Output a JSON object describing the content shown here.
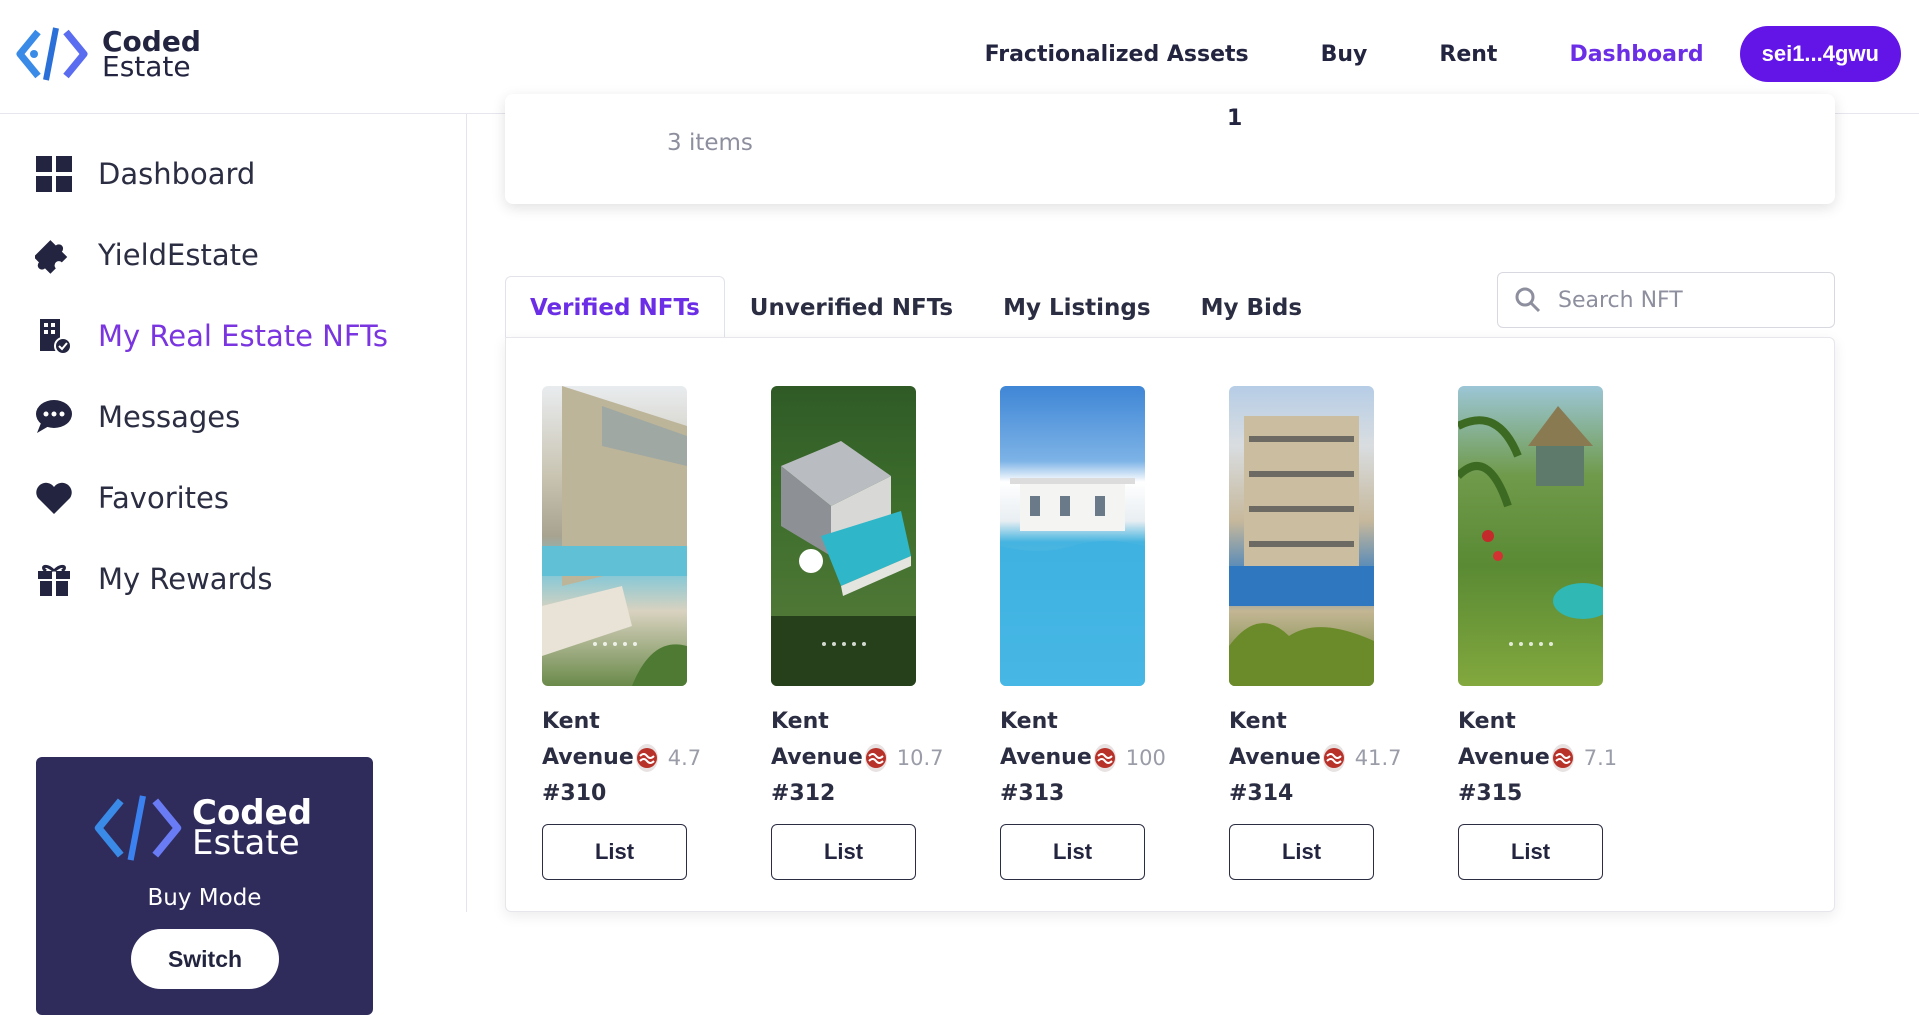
{
  "brand": {
    "line1": "Coded",
    "line2": "Estate"
  },
  "nav": {
    "links": [
      "Fractionalized Assets",
      "Buy",
      "Rent",
      "Dashboard"
    ],
    "active": "Dashboard",
    "wallet": "sei1...4gwu"
  },
  "sidebar": {
    "items": [
      {
        "label": "Dashboard",
        "icon": "grid-icon"
      },
      {
        "label": "YieldEstate",
        "icon": "puzzle-icon"
      },
      {
        "label": "My Real Estate NFTs",
        "icon": "building-check-icon",
        "active": true
      },
      {
        "label": "Messages",
        "icon": "chat-bubble-icon"
      },
      {
        "label": "Favorites",
        "icon": "heart-icon"
      },
      {
        "label": "My Rewards",
        "icon": "gift-icon"
      }
    ],
    "mode_card": {
      "brand_line1": "Coded",
      "brand_line2": "Estate",
      "label": "Buy Mode",
      "button": "Switch"
    }
  },
  "summary": {
    "items_text": "3 items",
    "value": "1"
  },
  "tabs": [
    "Verified NFTs",
    "Unverified NFTs",
    "My Listings",
    "My Bids"
  ],
  "active_tab": "Verified NFTs",
  "search": {
    "placeholder": "Search NFT"
  },
  "nfts": [
    {
      "name": "Kent",
      "name2": "Avenue",
      "price": "4.7",
      "id": "#310",
      "button": "List"
    },
    {
      "name": "Kent",
      "name2": "Avenue",
      "price": "10.7",
      "id": "#312",
      "button": "List"
    },
    {
      "name": "Kent",
      "name2": "Avenue",
      "price": "100",
      "id": "#313",
      "button": "List"
    },
    {
      "name": "Kent",
      "name2": "Avenue",
      "price": "41.7",
      "id": "#314",
      "button": "List"
    },
    {
      "name": "Kent",
      "name2": "Avenue",
      "price": "7.1",
      "id": "#315",
      "button": "List"
    }
  ],
  "colors": {
    "accent": "#6315e8",
    "active_text": "#7a35e0",
    "dark": "#23243f",
    "card_bg": "#2f2c5c"
  }
}
